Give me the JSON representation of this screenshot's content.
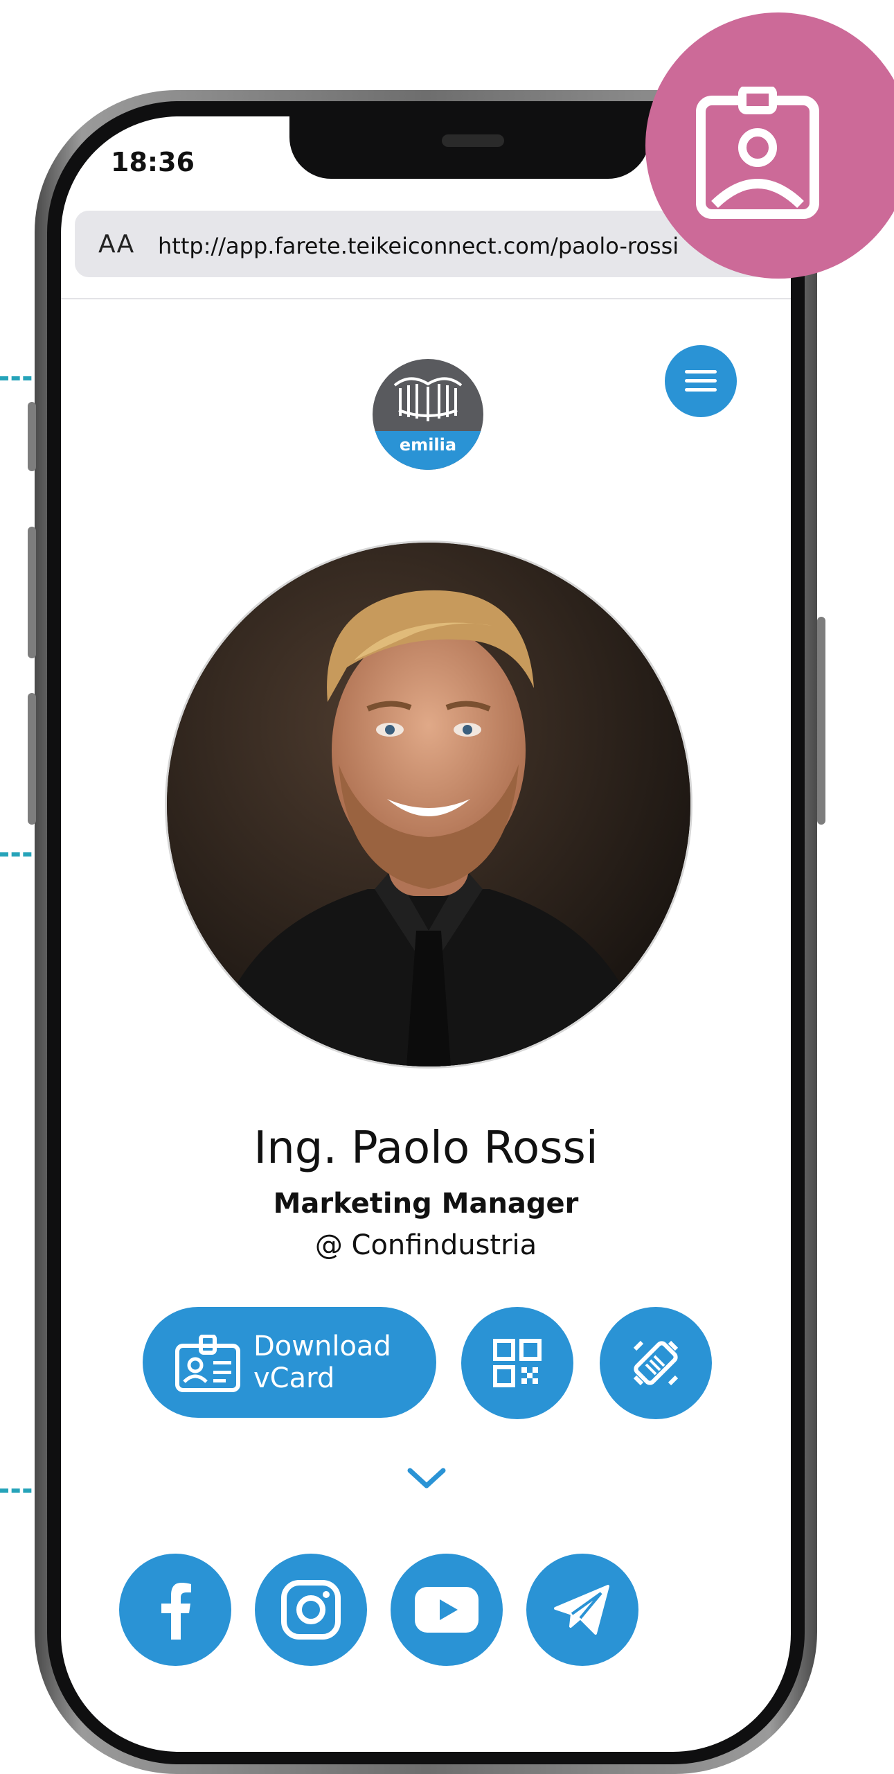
{
  "status": {
    "time": "18:36"
  },
  "browser": {
    "aa_label": "AA",
    "url": "http://app.farete.teikeiconnect.com/paolo-rossi"
  },
  "logo": {
    "text": "emilia"
  },
  "profile": {
    "name": "Ing. Paolo Rossi",
    "job_title": "Marketing Manager",
    "company": "@ Confindustria"
  },
  "actions": {
    "vcard_label_line1": "Download",
    "vcard_label_line2": "vCard"
  },
  "icons": {
    "menu": "hamburger-menu-icon",
    "vcard": "contact-card-icon",
    "qr": "qr-code-icon",
    "handshake": "handshake-icon",
    "chevron": "chevron-down-icon",
    "badge": "id-badge-icon",
    "facebook": "facebook-icon",
    "instagram": "instagram-icon",
    "youtube": "youtube-icon",
    "telegram": "telegram-icon"
  },
  "colors": {
    "accent": "#2a93d5",
    "badge": "#cc6a98",
    "callout": "#25a3b9"
  }
}
